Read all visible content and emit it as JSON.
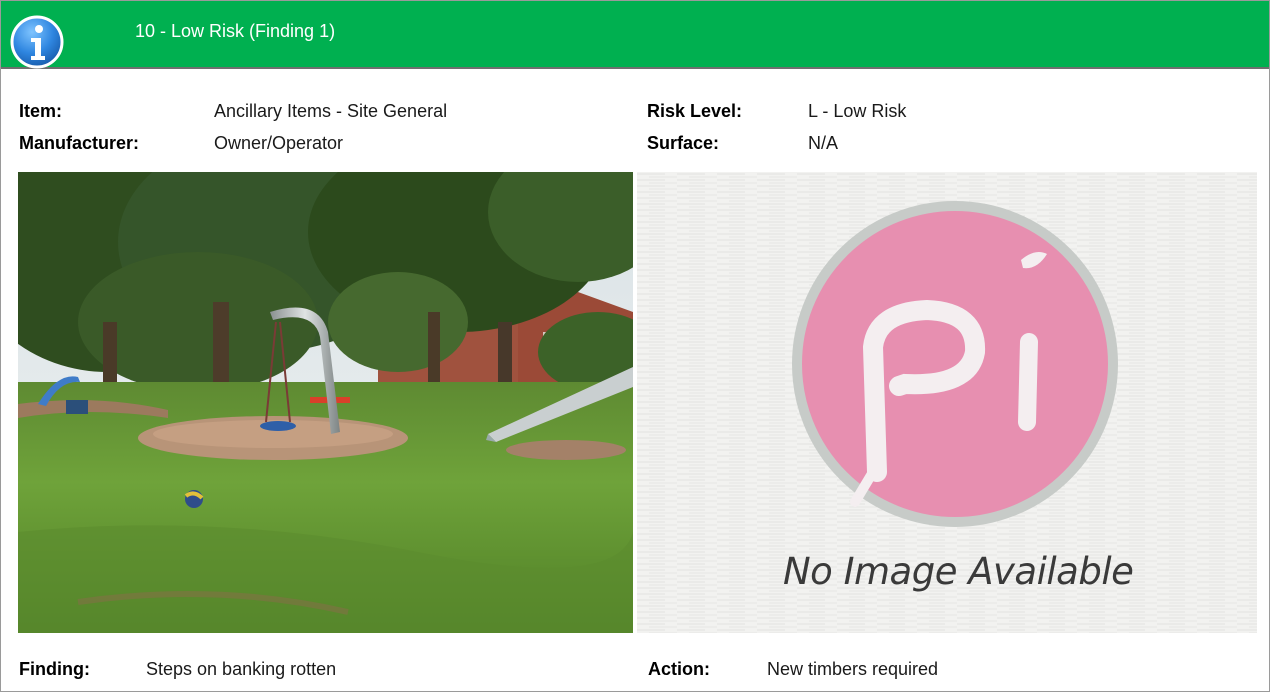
{
  "header": {
    "title": "10 - Low Risk (Finding 1)",
    "icon": "info-icon",
    "color": "#00b050"
  },
  "details": {
    "item_label": "Item:",
    "item_value": "Ancillary Items - Site General",
    "manufacturer_label": "Manufacturer:",
    "manufacturer_value": "Owner/Operator",
    "risk_label": "Risk Level:",
    "risk_value": "L - Low Risk",
    "surface_label": "Surface:",
    "surface_value": "N/A"
  },
  "images": {
    "photo": "playground-photo",
    "placeholder_text": "No Image Available"
  },
  "footer": {
    "finding_label": "Finding:",
    "finding_value": "Steps on banking rotten",
    "action_label": "Action:",
    "action_value": "New timbers required"
  }
}
